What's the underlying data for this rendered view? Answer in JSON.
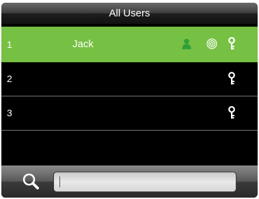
{
  "window": {
    "title": "All Users"
  },
  "users": [
    {
      "number": "1",
      "name": "Jack",
      "selected": true,
      "has_face": true,
      "has_fingerprint": true,
      "has_password": true
    },
    {
      "number": "2",
      "name": "",
      "selected": false,
      "has_face": false,
      "has_fingerprint": false,
      "has_password": true
    },
    {
      "number": "3",
      "name": "",
      "selected": false,
      "has_face": false,
      "has_fingerprint": false,
      "has_password": true
    }
  ],
  "search": {
    "value": "",
    "placeholder": ""
  },
  "colors": {
    "selected_row": "#76c043",
    "background": "#000000",
    "icon_on_green": "#2f9f3a"
  },
  "icons": {
    "search": "search-icon",
    "user": "user-icon",
    "fingerprint": "fingerprint-icon",
    "key": "key-icon"
  }
}
